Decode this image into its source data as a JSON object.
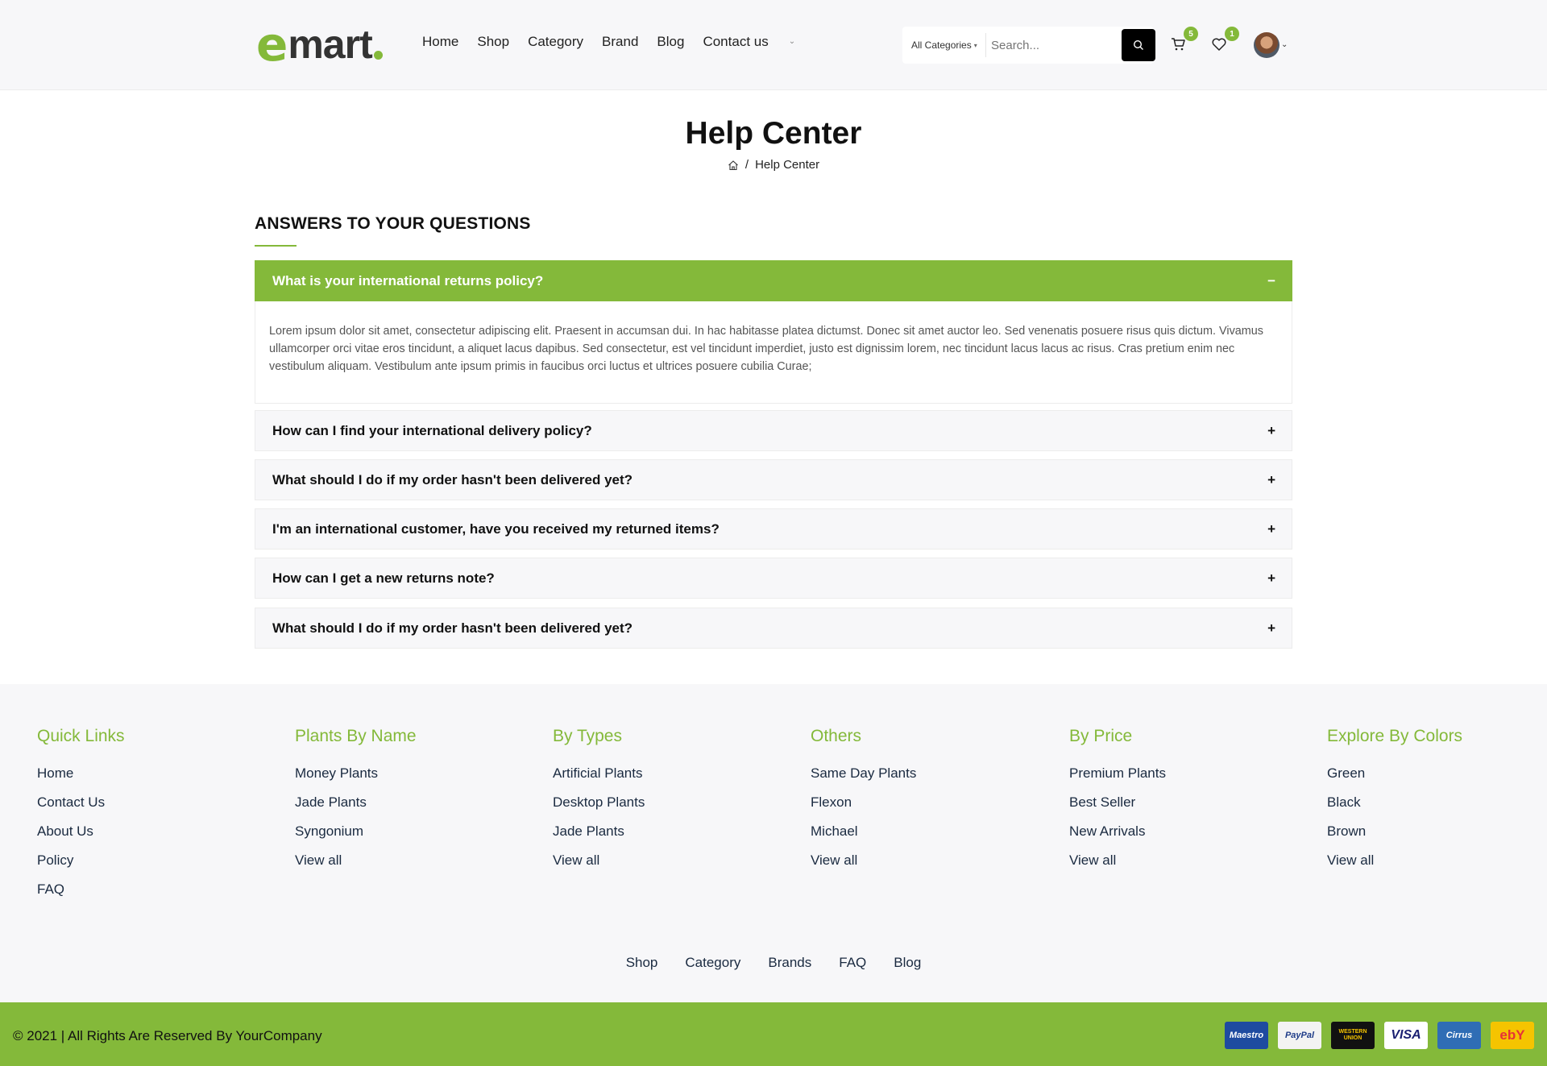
{
  "header": {
    "logo_letter": "e",
    "logo_rest": "mart",
    "nav": [
      "Home",
      "Shop",
      "Category",
      "Brand",
      "Blog",
      "Contact us"
    ],
    "search": {
      "category": "All Categories",
      "placeholder": "Search..."
    },
    "cart_count": "5",
    "wishlist_count": "1"
  },
  "page": {
    "title": "Help Center",
    "breadcrumb_current": "Help Center"
  },
  "faq": {
    "heading": "ANSWERS TO YOUR QUESTIONS",
    "open_item": {
      "question": "What is your international returns policy?",
      "toggle": "−",
      "answer": "Lorem ipsum dolor sit amet, consectetur adipiscing elit. Praesent in accumsan dui. In hac habitasse platea dictumst. Donec sit amet auctor leo. Sed venenatis posuere risus quis dictum. Vivamus ullamcorper orci vitae eros tincidunt, a aliquet lacus dapibus. Sed consectetur, est vel tincidunt imperdiet, justo est dignissim lorem, nec tincidunt lacus lacus ac risus. Cras pretium enim nec vestibulum aliquam. Vestibulum ante ipsum primis in faucibus orci luctus et ultrices posuere cubilia Curae;"
    },
    "collapsed_items": [
      {
        "question": "How can I find your international delivery policy?",
        "toggle": "+"
      },
      {
        "question": "What should I do if my order hasn't been delivered yet?",
        "toggle": "+"
      },
      {
        "question": "I'm an international customer, have you received my returned items?",
        "toggle": "+"
      },
      {
        "question": "How can I get a new returns note?",
        "toggle": "+"
      },
      {
        "question": "What should I do if my order hasn't been delivered yet?",
        "toggle": "+"
      }
    ]
  },
  "footer": {
    "columns": [
      {
        "title": "Quick Links",
        "links": [
          "Home",
          "Contact Us",
          "About Us",
          "Policy",
          "FAQ"
        ]
      },
      {
        "title": "Plants By Name",
        "links": [
          "Money Plants",
          "Jade Plants",
          "Syngonium",
          "View all"
        ]
      },
      {
        "title": "By Types",
        "links": [
          "Artificial Plants",
          "Desktop Plants",
          "Jade Plants",
          "View all"
        ]
      },
      {
        "title": "Others",
        "links": [
          "Same Day Plants",
          "Flexon",
          "Michael",
          "View all"
        ]
      },
      {
        "title": "By Price",
        "links": [
          "Premium Plants",
          "Best Seller",
          "New Arrivals",
          "View all"
        ]
      },
      {
        "title": "Explore By Colors",
        "links": [
          "Green",
          "Black",
          "Brown",
          "View all"
        ]
      }
    ],
    "bottom_links": [
      "Shop",
      "Category",
      "Brands",
      "FAQ",
      "Blog"
    ],
    "copyright": "© 2021 | All Rights Are Reserved By YourCompany",
    "payments": [
      {
        "name": "Maestro",
        "label": "Maestro",
        "bg": "#1e4ba0",
        "fg": "#ffffff"
      },
      {
        "name": "PayPal",
        "label": "PayPal",
        "bg": "#f3f3f3",
        "fg": "#1f3c88"
      },
      {
        "name": "Western Union",
        "label": "WESTERN UNION",
        "bg": "#111111",
        "fg": "#f5c400"
      },
      {
        "name": "Visa",
        "label": "VISA",
        "bg": "#ffffff",
        "fg": "#1a1f71"
      },
      {
        "name": "Cirrus",
        "label": "Cirrus",
        "bg": "#2f6db5",
        "fg": "#ffffff"
      },
      {
        "name": "eBay",
        "label": "ebY",
        "bg": "#f5c400",
        "fg": "#e53238"
      }
    ]
  },
  "colors": {
    "accent": "#84b93a",
    "footer_bg": "#f7f7f9"
  }
}
